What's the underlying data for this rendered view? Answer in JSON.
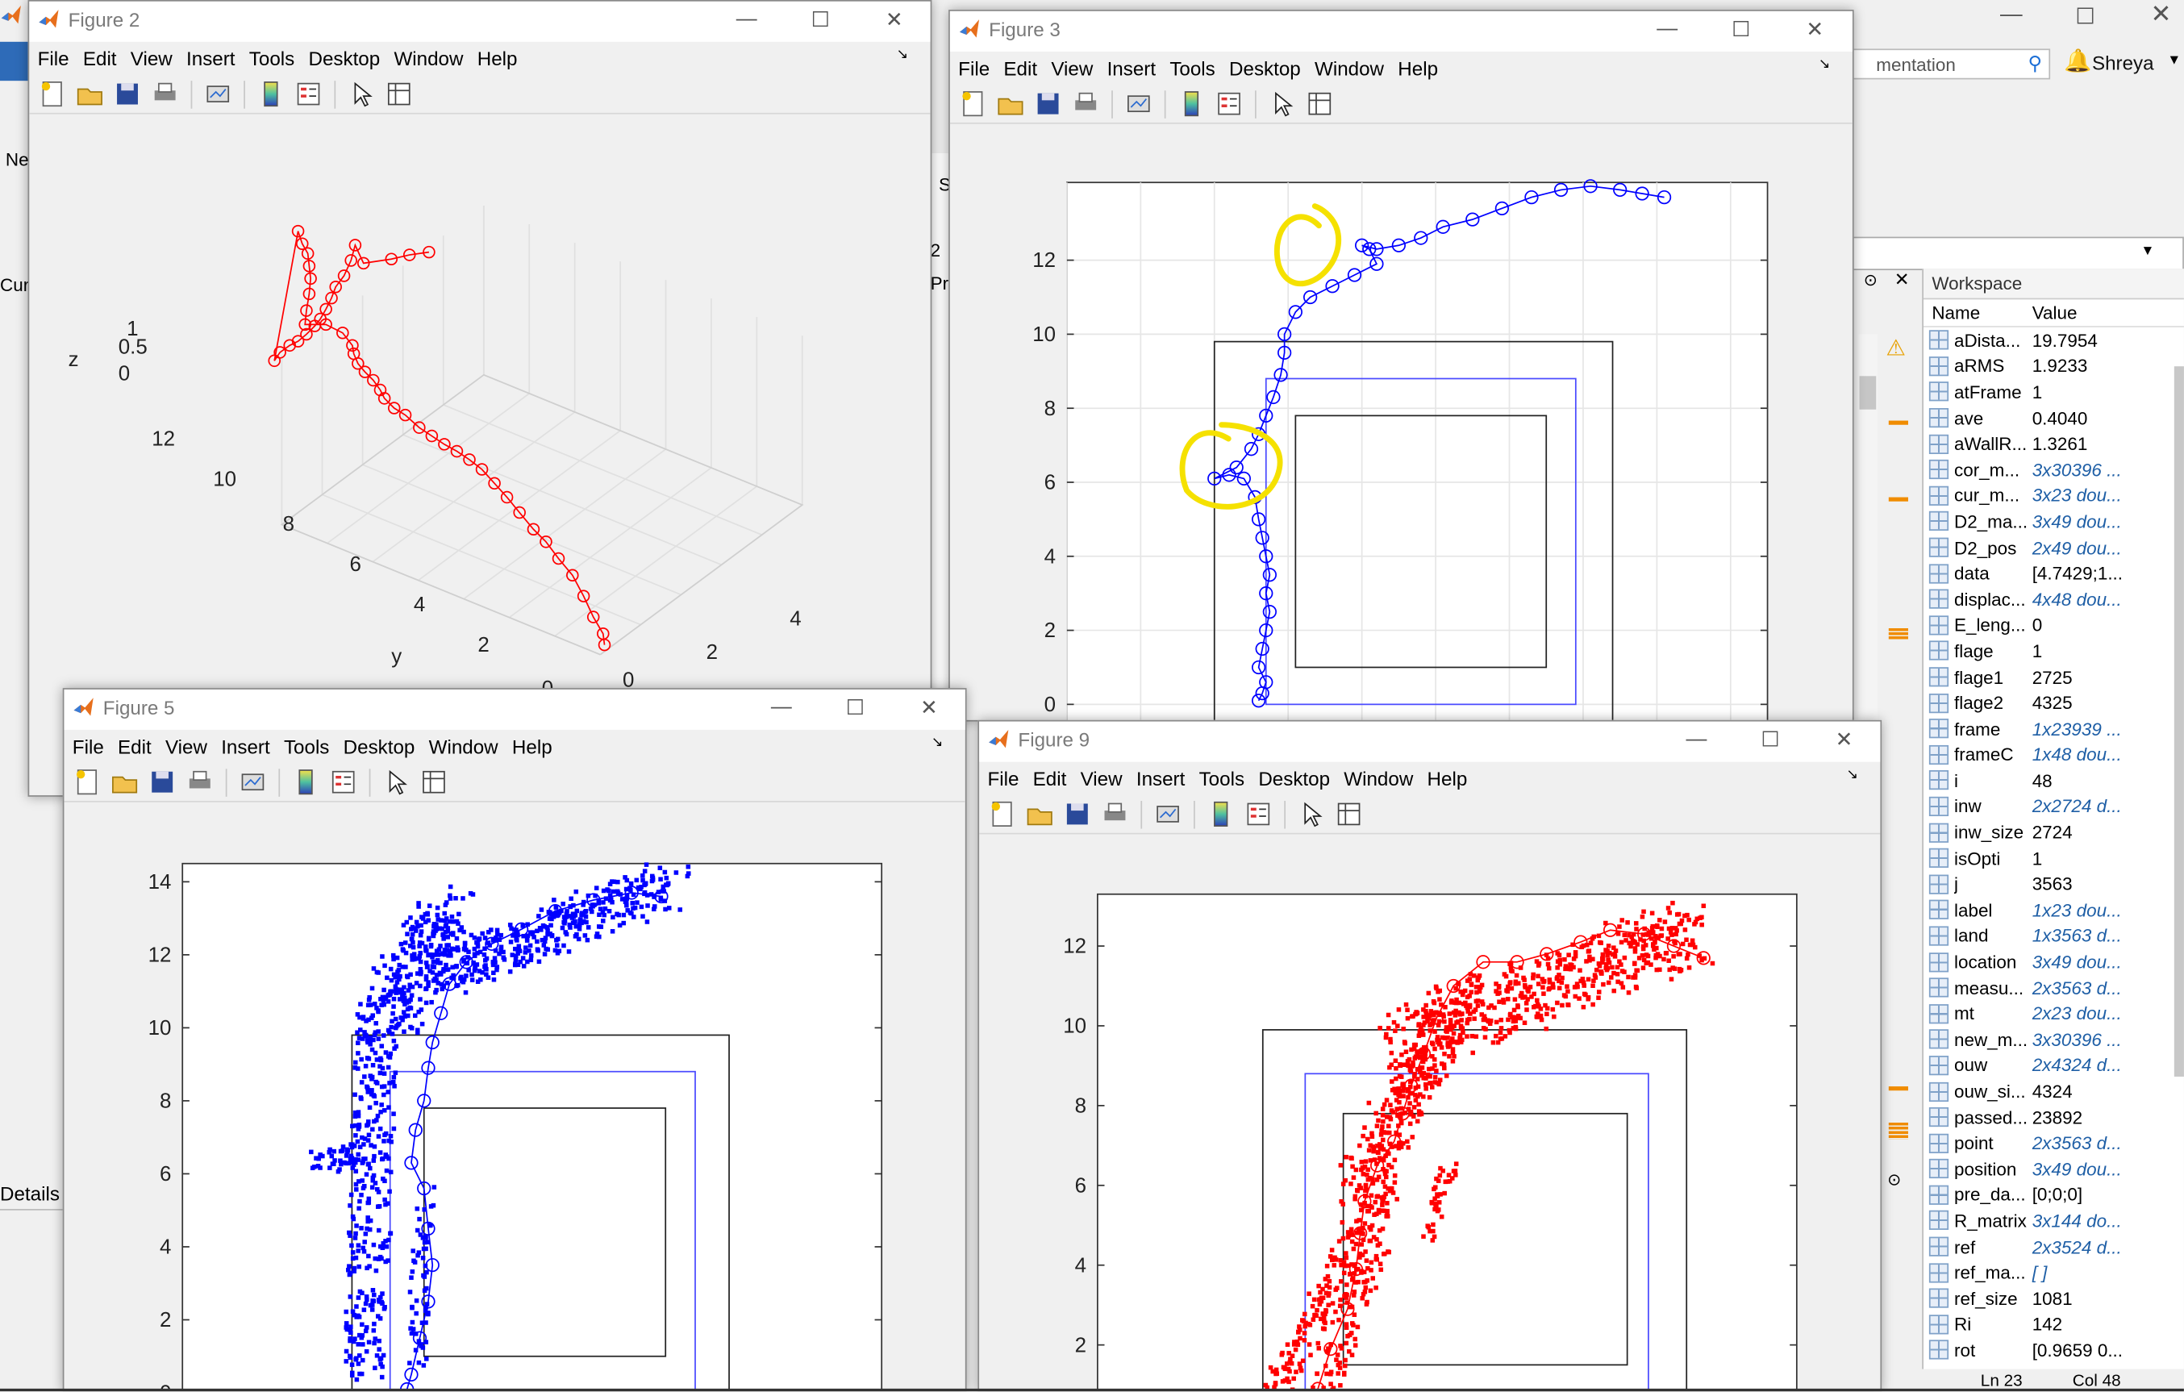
{
  "main_window": {
    "search_placeholder": "mentation",
    "user": "Shreya",
    "left_labels": [
      "Ne",
      "Cur",
      "Details"
    ],
    "mid_labels": [
      "S",
      "2",
      "Pr"
    ]
  },
  "workspace": {
    "title": "Workspace",
    "col_name": "Name",
    "col_value": "Value",
    "rows": [
      {
        "name": "aDista...",
        "value": "19.7954",
        "italic": false
      },
      {
        "name": "aRMS",
        "value": "1.9233",
        "italic": false
      },
      {
        "name": "atFrame",
        "value": "1",
        "italic": false
      },
      {
        "name": "ave",
        "value": "0.4040",
        "italic": false
      },
      {
        "name": "aWallR...",
        "value": "1.3261",
        "italic": false
      },
      {
        "name": "cor_m...",
        "value": "3x30396 ...",
        "italic": true
      },
      {
        "name": "cur_m...",
        "value": "3x23 dou...",
        "italic": true
      },
      {
        "name": "D2_ma...",
        "value": "3x49 dou...",
        "italic": true
      },
      {
        "name": "D2_pos",
        "value": "2x49 dou...",
        "italic": true
      },
      {
        "name": "data",
        "value": "[4.7429;1...",
        "italic": false
      },
      {
        "name": "displac...",
        "value": "4x48 dou...",
        "italic": true
      },
      {
        "name": "E_leng...",
        "value": "0",
        "italic": false
      },
      {
        "name": "flage",
        "value": "1",
        "italic": false
      },
      {
        "name": "flage1",
        "value": "2725",
        "italic": false
      },
      {
        "name": "flage2",
        "value": "4325",
        "italic": false
      },
      {
        "name": "frame",
        "value": "1x23939 ...",
        "italic": true
      },
      {
        "name": "frameC",
        "value": "1x48 dou...",
        "italic": true
      },
      {
        "name": "i",
        "value": "48",
        "italic": false
      },
      {
        "name": "inw",
        "value": "2x2724 d...",
        "italic": true
      },
      {
        "name": "inw_size",
        "value": "2724",
        "italic": false
      },
      {
        "name": "isOpti",
        "value": "1",
        "italic": false
      },
      {
        "name": "j",
        "value": "3563",
        "italic": false
      },
      {
        "name": "label",
        "value": "1x23 dou...",
        "italic": true
      },
      {
        "name": "land",
        "value": "1x3563 d...",
        "italic": true
      },
      {
        "name": "location",
        "value": "3x49 dou...",
        "italic": true
      },
      {
        "name": "measu...",
        "value": "2x3563 d...",
        "italic": true
      },
      {
        "name": "mt",
        "value": "2x23 dou...",
        "italic": true
      },
      {
        "name": "new_m...",
        "value": "3x30396 ...",
        "italic": true
      },
      {
        "name": "ouw",
        "value": "2x4324 d...",
        "italic": true
      },
      {
        "name": "ouw_si...",
        "value": "4324",
        "italic": false
      },
      {
        "name": "passed...",
        "value": "23892",
        "italic": false
      },
      {
        "name": "point",
        "value": "2x3563 d...",
        "italic": true
      },
      {
        "name": "position",
        "value": "3x49 dou...",
        "italic": true
      },
      {
        "name": "pre_da...",
        "value": "[0;0;0]",
        "italic": false
      },
      {
        "name": "R_matrix",
        "value": "3x144 do...",
        "italic": true
      },
      {
        "name": "ref",
        "value": "2x3524 d...",
        "italic": true
      },
      {
        "name": "ref_ma...",
        "value": "[ ]",
        "italic": true
      },
      {
        "name": "ref_size",
        "value": "1081",
        "italic": false
      },
      {
        "name": "Ri",
        "value": "142",
        "italic": false
      },
      {
        "name": "rot",
        "value": "[0.9659 0...",
        "italic": false
      }
    ]
  },
  "status": {
    "ln": "Ln 23",
    "col": "Col 48"
  },
  "menu": [
    "File",
    "Edit",
    "View",
    "Insert",
    "Tools",
    "Desktop",
    "Window",
    "Help"
  ],
  "fig2": {
    "title": "Figure 2",
    "zlabel": "z",
    "ylabel": "y",
    "zticks": [
      "1",
      "0.5",
      "0"
    ],
    "yticks": [
      "12",
      "10",
      "8",
      "6",
      "4",
      "2",
      "0"
    ],
    "xticks": [
      "4",
      "2",
      "0"
    ]
  },
  "fig3": {
    "title": "Figure 3",
    "yticks": [
      "12",
      "10",
      "8",
      "6",
      "4",
      "2",
      "0"
    ]
  },
  "fig5": {
    "title": "Figure 5",
    "yticks": [
      "14",
      "12",
      "10",
      "8",
      "6",
      "4",
      "2",
      "0"
    ]
  },
  "fig9": {
    "title": "Figure 9",
    "yticks": [
      "12",
      "10",
      "8",
      "6",
      "4",
      "2"
    ]
  },
  "colors": {
    "traj_blue": "#0000ff",
    "traj_red": "#ff0000",
    "highlight": "#f5e100",
    "room_blue": "#4a4aff"
  }
}
